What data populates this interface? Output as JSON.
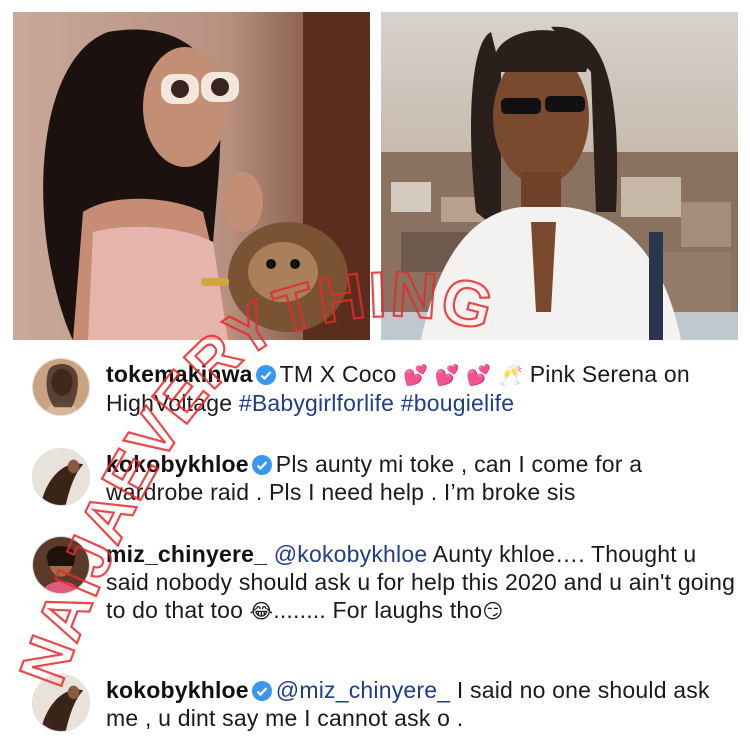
{
  "comments": [
    {
      "username": "tokemakinwa",
      "verified": true,
      "parts": [
        {
          "type": "text",
          "value": "TM X Coco "
        },
        {
          "type": "emoji",
          "value": "💕 💕 💕 🥂"
        },
        {
          "type": "text",
          "value": " Pink Serena on HighVoltage "
        },
        {
          "type": "hashtag",
          "value": "#Babygirlforlife"
        },
        {
          "type": "text",
          "value": " "
        },
        {
          "type": "hashtag",
          "value": "#bougielife"
        }
      ]
    },
    {
      "username": "kokobykhloe",
      "verified": true,
      "parts": [
        {
          "type": "text",
          "value": "Pls aunty mi toke , can I come for a wardrobe raid . Pls I need help . I’m broke sis"
        }
      ]
    },
    {
      "username": "miz_chinyere_",
      "verified": false,
      "parts": [
        {
          "type": "mention",
          "value": "@kokobykhloe"
        },
        {
          "type": "text",
          "value": " Aunty khloe…. Thought u said nobody should ask u for help this 2020 and u ain't going to do that too "
        },
        {
          "type": "emoji",
          "value": "😂"
        },
        {
          "type": "text",
          "value": "........ For laughs tho"
        },
        {
          "type": "emoji",
          "value": "😏"
        }
      ]
    },
    {
      "username": "kokobykhloe",
      "verified": true,
      "parts": [
        {
          "type": "mention",
          "value": "@miz_chinyere_"
        },
        {
          "type": "text",
          "value": " I said no one should ask me , u dint say me I cannot ask o ."
        }
      ]
    }
  ],
  "watermark": {
    "text": "NAIJAEVERYTHING",
    "color": "#e8292b"
  },
  "colors": {
    "verified_badge": "#3897f0",
    "mention": "#1e3d8a"
  },
  "icons": {
    "verified": "verified-badge-icon"
  }
}
